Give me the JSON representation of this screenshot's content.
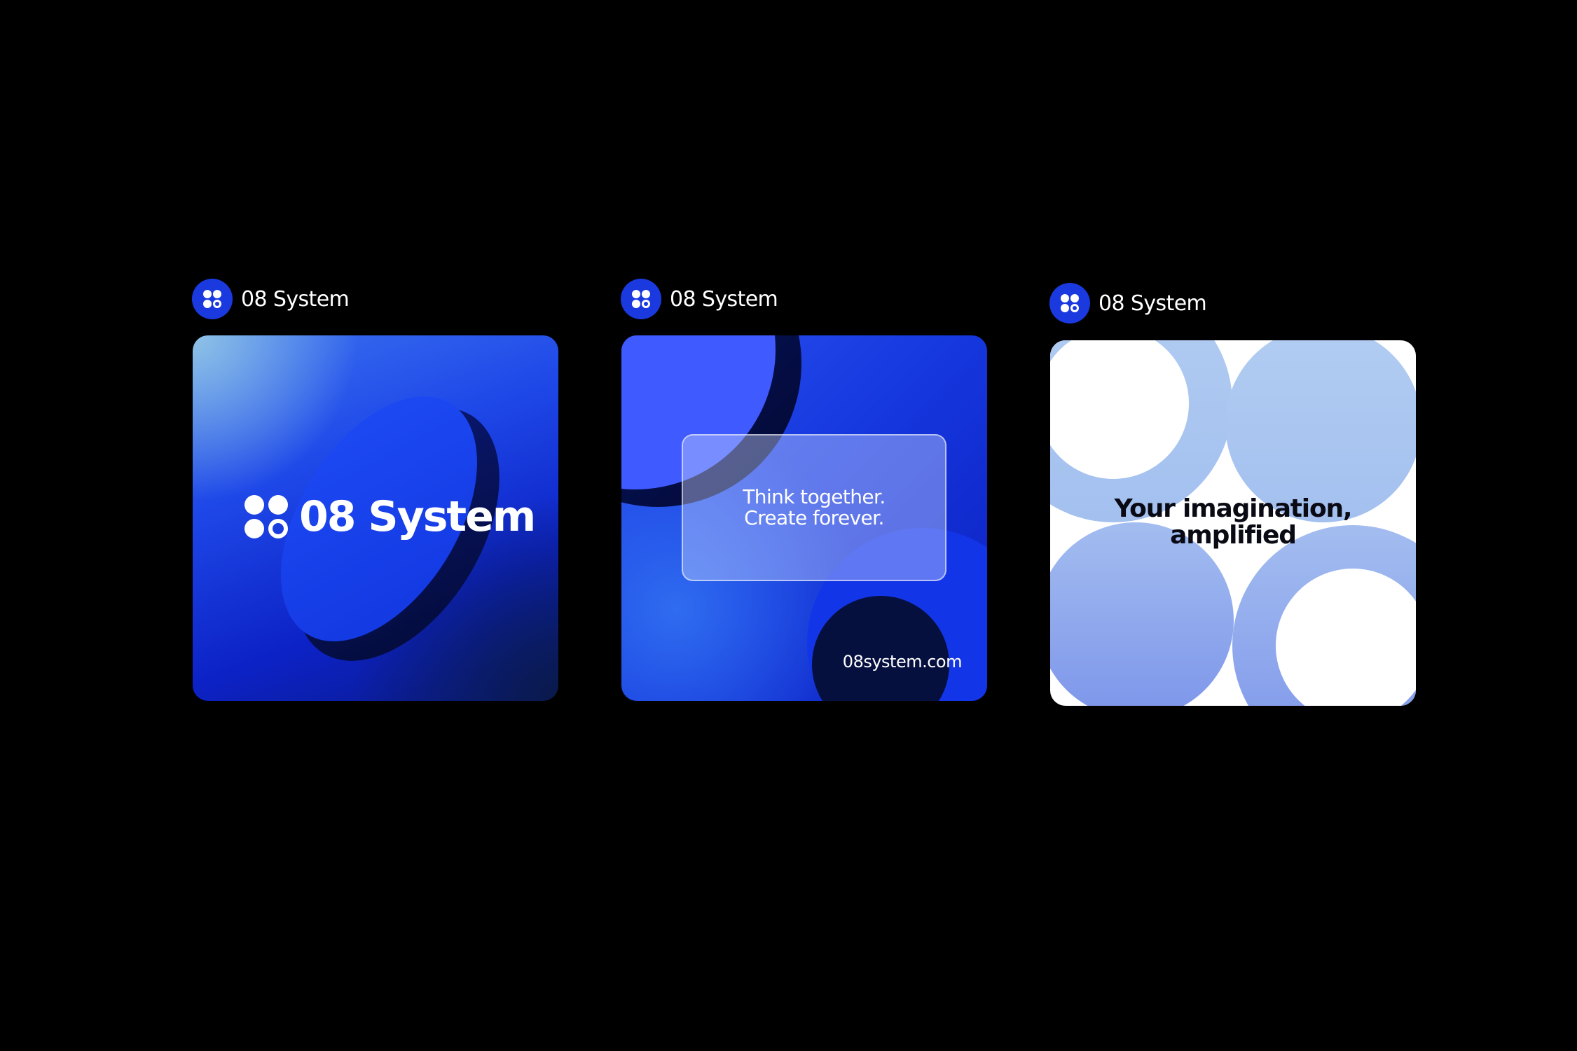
{
  "colors": {
    "background": "#000000",
    "brand_blue": "#1a3ae0",
    "light_blue": "#a9c6f0",
    "text_white": "#ffffff",
    "text_dark": "#0a0a14"
  },
  "posts": [
    {
      "account_name": "08 System",
      "avatar_icon": "four-circles-logo-icon",
      "card": {
        "logo_icon": "four-circles-logo-icon",
        "brand_text": "08 System"
      }
    },
    {
      "account_name": "08 System",
      "avatar_icon": "four-circles-logo-icon",
      "card": {
        "headline_line1": "Think together.",
        "headline_line2": "Create forever.",
        "url": "08system.com"
      }
    },
    {
      "account_name": "08 System",
      "avatar_icon": "four-circles-logo-icon",
      "card": {
        "tagline_line1": "Your imagination,",
        "tagline_line2": "amplified"
      }
    }
  ]
}
